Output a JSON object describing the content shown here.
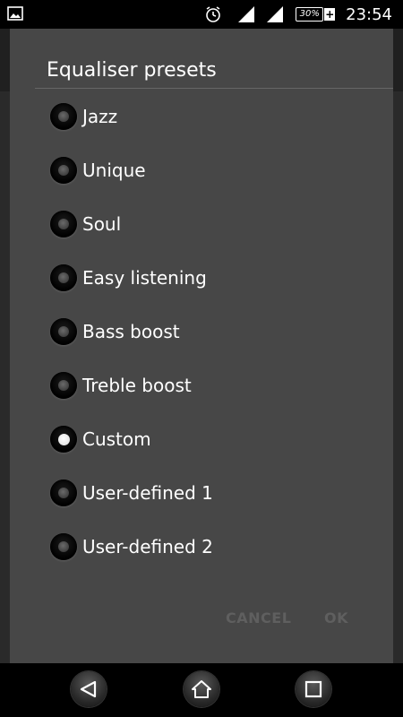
{
  "status_bar": {
    "battery_percent": "30%",
    "charging_symbol": "+",
    "time": "23:54",
    "icons": [
      "image-icon",
      "alarm-icon",
      "signal-icon",
      "signal-icon",
      "battery-icon"
    ]
  },
  "dialog": {
    "title": "Equaliser presets",
    "options": [
      {
        "label": "Jazz",
        "selected": false
      },
      {
        "label": "Unique",
        "selected": false
      },
      {
        "label": "Soul",
        "selected": false
      },
      {
        "label": "Easy listening",
        "selected": false
      },
      {
        "label": "Bass boost",
        "selected": false
      },
      {
        "label": "Treble boost",
        "selected": false
      },
      {
        "label": "Custom",
        "selected": true
      },
      {
        "label": "User-defined 1",
        "selected": false
      },
      {
        "label": "User-defined 2",
        "selected": false
      }
    ],
    "buttons": {
      "cancel": "CANCEL",
      "ok": "OK"
    }
  },
  "nav_bar": {
    "icons": [
      "back-icon",
      "home-icon",
      "recents-icon"
    ]
  },
  "colors": {
    "dialog_bg": "#474747",
    "disabled_button_text": "#5f5f5f",
    "text": "#ffffff"
  }
}
